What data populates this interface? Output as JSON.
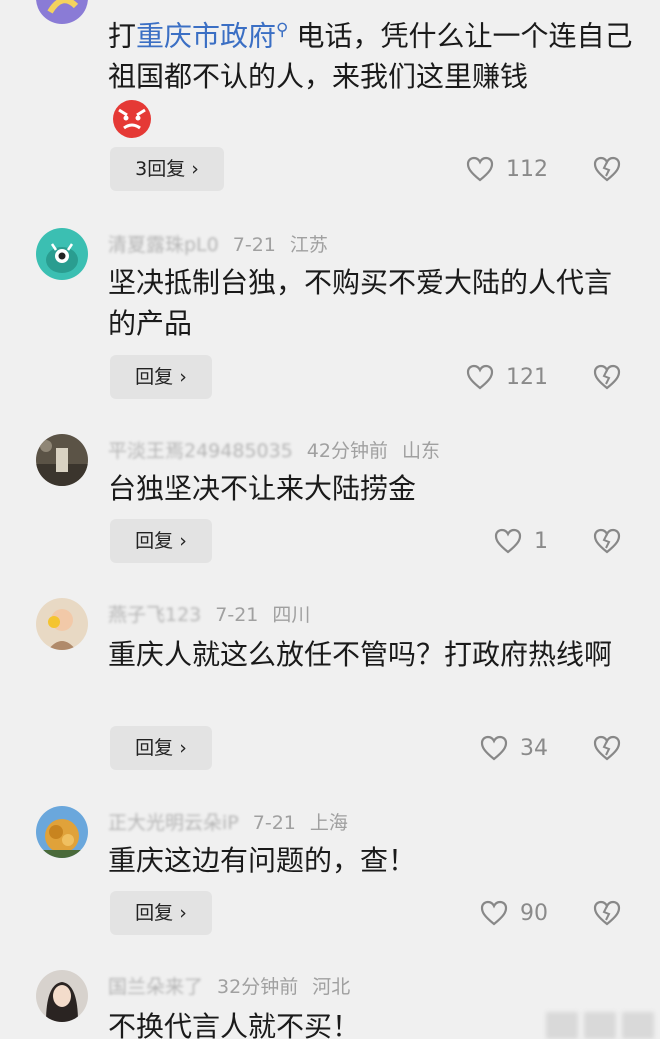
{
  "comments": [
    {
      "text_pre": "打",
      "text_link": "重庆市政府",
      "text_search_icon": "search-icon",
      "text_post": "电话，凭什么让一个连自己祖国都不认的人，来我们这里赚钱",
      "emoji": "angry-face-icon",
      "reply_label": "3回复 ›",
      "likes": "112"
    },
    {
      "username": "清夏露珠pL0",
      "date": "7-21",
      "location": "江苏",
      "text": "坚决抵制台独，不购买不爱大陆的人代言的产品",
      "reply_label": "回复 ›",
      "likes": "121"
    },
    {
      "username": "平淡王焉249485035",
      "date": "42分钟前",
      "location": "山东",
      "text": "台独坚决不让来大陆捞金",
      "reply_label": "回复 ›",
      "likes": "1"
    },
    {
      "username": "燕子飞123",
      "date": "7-21",
      "location": "四川",
      "text": "重庆人就这么放任不管吗？打政府热线啊",
      "reply_label": "回复 ›",
      "likes": "34"
    },
    {
      "username": "正大光明云朵iP",
      "date": "7-21",
      "location": "上海",
      "text": "重庆这边有问题的，查！",
      "reply_label": "回复 ›",
      "likes": "90"
    },
    {
      "username": "国兰朵来了",
      "date": "32分钟前",
      "location": "河北",
      "text": "不换代言人就不买！"
    }
  ],
  "colors": {
    "background": "#f0f0f0",
    "link": "#3b6fc4",
    "meta": "#a0a0a0",
    "reply_bg": "#e3e3e3"
  }
}
